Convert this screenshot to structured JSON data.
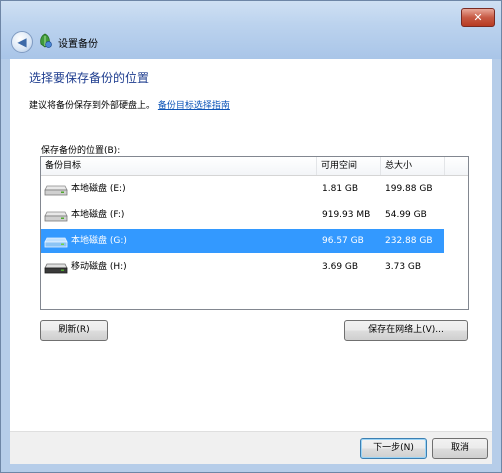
{
  "window": {
    "title": "设置备份",
    "close_glyph": "✕",
    "back_glyph": "◀"
  },
  "page": {
    "heading": "选择要保存备份的位置",
    "subtext": "建议将备份保存到外部硬盘上。",
    "help_link": "备份目标选择指南",
    "list_label": "保存备份的位置(B):"
  },
  "table": {
    "columns": [
      "备份目标",
      "可用空间",
      "总大小"
    ],
    "rows": [
      {
        "name": "本地磁盘 (E:)",
        "free": "1.81 GB",
        "total": "199.88 GB",
        "icon": "hard-drive-icon",
        "selected": false
      },
      {
        "name": "本地磁盘 (F:)",
        "free": "919.93 MB",
        "total": "54.99 GB",
        "icon": "hard-drive-icon",
        "selected": false
      },
      {
        "name": "本地磁盘 (G:)",
        "free": "96.57 GB",
        "total": "232.88 GB",
        "icon": "hard-drive-icon",
        "selected": true
      },
      {
        "name": "移动磁盘 (H:)",
        "free": "3.69 GB",
        "total": "3.73 GB",
        "icon": "removable-drive-icon",
        "selected": false
      }
    ]
  },
  "buttons": {
    "refresh": "刷新(R)",
    "save_network": "保存在网络上(V)...",
    "next": "下一步(N)",
    "cancel": "取消"
  },
  "colors": {
    "heading": "#1e3d8f",
    "link": "#0d55b8",
    "selection": "#3399ff",
    "frame": "#b6cde9"
  }
}
